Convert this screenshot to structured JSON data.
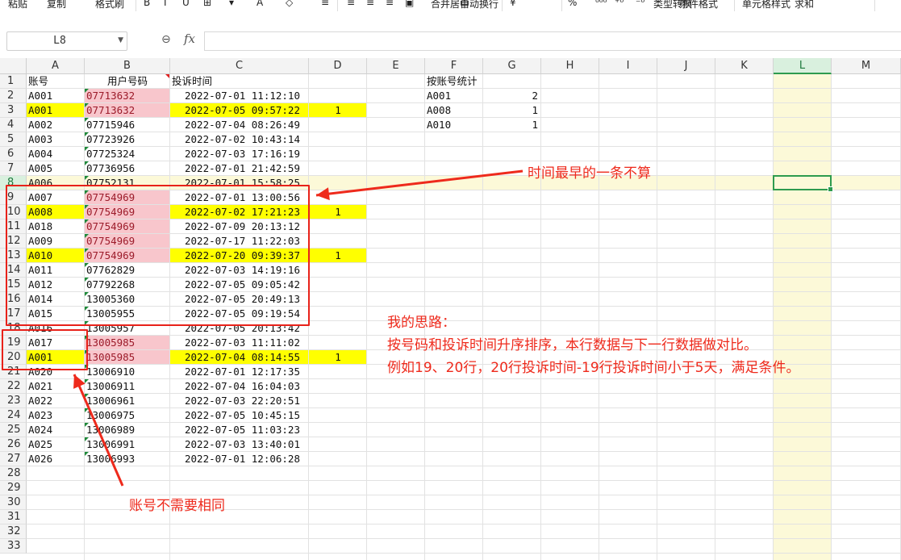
{
  "toolbar": {
    "items": [
      "粘贴",
      "复制",
      "格式刷",
      "B",
      "I",
      "U",
      "⊞",
      "▾",
      "A",
      "◇",
      "≡",
      "≡",
      "≡",
      "≡",
      "▣",
      "合并居中",
      "自动换行",
      "¥",
      "%",
      "⁰⁰⁰",
      "⁺⁰",
      "⁻⁰",
      "类型转换",
      "条件格式",
      "单元格样式",
      "求和"
    ]
  },
  "formula_bar": {
    "name_box": "L8",
    "fx_label": "fx",
    "formula": ""
  },
  "columns": [
    "A",
    "B",
    "C",
    "D",
    "E",
    "F",
    "G",
    "H",
    "I",
    "J",
    "K",
    "L",
    "M"
  ],
  "selected_column": "L",
  "selected_row": 8,
  "row_numbers": [
    1,
    2,
    3,
    4,
    5,
    6,
    7,
    8,
    9,
    10,
    11,
    12,
    13,
    14,
    15,
    16,
    17,
    18,
    19,
    20,
    21,
    22,
    23,
    24,
    25,
    26,
    27,
    28,
    29,
    30,
    31,
    32,
    33
  ],
  "header_row": {
    "A": "账号",
    "B": "用户号码",
    "C": "投诉时间",
    "F": "按账号统计"
  },
  "rows": [
    {
      "A": "A001",
      "B": "07713632",
      "C": "2022-07-01 11:12:10",
      "D": "",
      "pink": true,
      "yellow": false
    },
    {
      "A": "A001",
      "B": "07713632",
      "C": "2022-07-05 09:57:22",
      "D": "1",
      "pink": true,
      "yellow": true
    },
    {
      "A": "A002",
      "B": "07715946",
      "C": "2022-07-04 08:26:49",
      "D": "",
      "pink": false,
      "yellow": false
    },
    {
      "A": "A003",
      "B": "07723926",
      "C": "2022-07-02 10:43:14",
      "D": "",
      "pink": false,
      "yellow": false
    },
    {
      "A": "A004",
      "B": "07725324",
      "C": "2022-07-03 17:16:19",
      "D": "",
      "pink": false,
      "yellow": false
    },
    {
      "A": "A005",
      "B": "07736956",
      "C": "2022-07-01 21:42:59",
      "D": "",
      "pink": false,
      "yellow": false
    },
    {
      "A": "A006",
      "B": "07752131",
      "C": "2022-07-01 15:58:25",
      "D": "",
      "pink": false,
      "yellow": false
    },
    {
      "A": "A007",
      "B": "07754969",
      "C": "2022-07-01 13:00:56",
      "D": "",
      "pink": true,
      "yellow": false
    },
    {
      "A": "A008",
      "B": "07754969",
      "C": "2022-07-02 17:21:23",
      "D": "1",
      "pink": true,
      "yellow": true
    },
    {
      "A": "A018",
      "B": "07754969",
      "C": "2022-07-09 20:13:12",
      "D": "",
      "pink": true,
      "yellow": false
    },
    {
      "A": "A009",
      "B": "07754969",
      "C": "2022-07-17 11:22:03",
      "D": "",
      "pink": true,
      "yellow": false
    },
    {
      "A": "A010",
      "B": "07754969",
      "C": "2022-07-20 09:39:37",
      "D": "1",
      "pink": true,
      "yellow": true
    },
    {
      "A": "A011",
      "B": "07762829",
      "C": "2022-07-03 14:19:16",
      "D": "",
      "pink": false,
      "yellow": false
    },
    {
      "A": "A012",
      "B": "07792268",
      "C": "2022-07-05 09:05:42",
      "D": "",
      "pink": false,
      "yellow": false
    },
    {
      "A": "A014",
      "B": "13005360",
      "C": "2022-07-05 20:49:13",
      "D": "",
      "pink": false,
      "yellow": false
    },
    {
      "A": "A015",
      "B": "13005955",
      "C": "2022-07-05 09:19:54",
      "D": "",
      "pink": false,
      "yellow": false
    },
    {
      "A": "A016",
      "B": "13005957",
      "C": "2022-07-05 20:13:42",
      "D": "",
      "pink": false,
      "yellow": false
    },
    {
      "A": "A017",
      "B": "13005985",
      "C": "2022-07-03 11:11:02",
      "D": "",
      "pink": true,
      "yellow": false
    },
    {
      "A": "A001",
      "B": "13005985",
      "C": "2022-07-04 08:14:55",
      "D": "1",
      "pink": true,
      "yellow": true
    },
    {
      "A": "A020",
      "B": "13006910",
      "C": "2022-07-01 12:17:35",
      "D": "",
      "pink": false,
      "yellow": false
    },
    {
      "A": "A021",
      "B": "13006911",
      "C": "2022-07-04 16:04:03",
      "D": "",
      "pink": false,
      "yellow": false
    },
    {
      "A": "A022",
      "B": "13006961",
      "C": "2022-07-03 22:20:51",
      "D": "",
      "pink": false,
      "yellow": false
    },
    {
      "A": "A023",
      "B": "13006975",
      "C": "2022-07-05 10:45:15",
      "D": "",
      "pink": false,
      "yellow": false
    },
    {
      "A": "A024",
      "B": "13006989",
      "C": "2022-07-05 11:03:23",
      "D": "",
      "pink": false,
      "yellow": false
    },
    {
      "A": "A025",
      "B": "13006991",
      "C": "2022-07-03 13:40:01",
      "D": "",
      "pink": false,
      "yellow": false
    },
    {
      "A": "A026",
      "B": "13006993",
      "C": "2022-07-01 12:06:28",
      "D": "",
      "pink": false,
      "yellow": false
    }
  ],
  "stats": [
    {
      "F": "A001",
      "G": "2"
    },
    {
      "F": "A008",
      "G": "1"
    },
    {
      "F": "A010",
      "G": "1"
    }
  ],
  "annotations": {
    "earliest_note": "时间最早的一条不算",
    "thinking_title": "我的思路：",
    "thinking_line1": "按号码和投诉时间升序排序，本行数据与下一行数据做对比。",
    "thinking_line2": "例如19、20行，20行投诉时间-19行投诉时间小于5天，满足条件。",
    "account_note": "账号不需要相同"
  },
  "colors": {
    "highlight_yellow": "#ffff00",
    "dup_pink": "#f8c6cc",
    "annotation_red": "#ee2a1c",
    "selection_green": "#2e9b4f"
  }
}
